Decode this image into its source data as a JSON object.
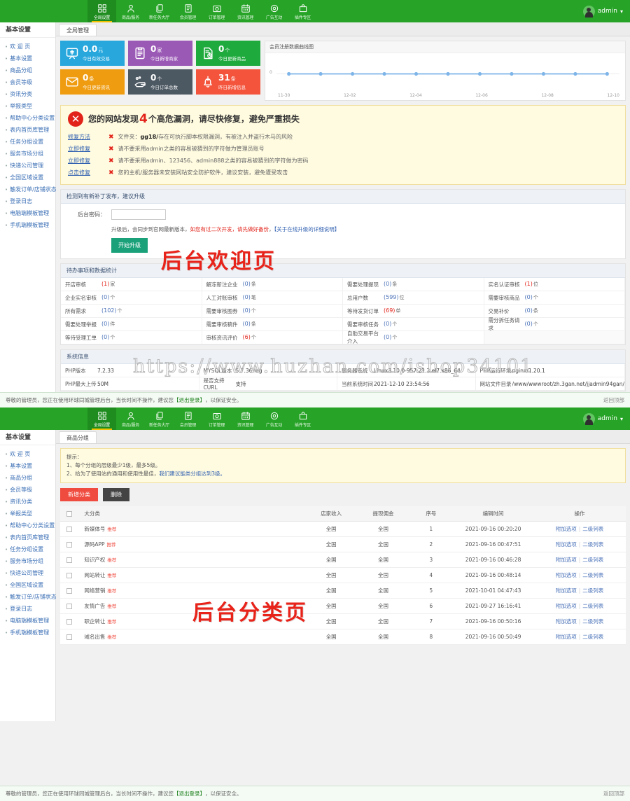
{
  "nav": {
    "items": [
      {
        "label": "全局设置",
        "icon": "grid-icon",
        "active": true
      },
      {
        "label": "商品/服务",
        "icon": "user-icon",
        "active": false
      },
      {
        "label": "新任务大厅",
        "icon": "copy-icon",
        "active": false
      },
      {
        "label": "会员管理",
        "icon": "book-icon",
        "active": false
      },
      {
        "label": "订单管理",
        "icon": "camera-icon",
        "active": false
      },
      {
        "label": "资讯管理",
        "icon": "calendar-icon",
        "active": false
      },
      {
        "label": "广告互动",
        "icon": "gear-icon",
        "active": false
      },
      {
        "label": "插件专区",
        "icon": "bag-icon",
        "active": false
      }
    ],
    "user": "admin",
    "caret": "▾"
  },
  "sidebar": {
    "title": "基本设置",
    "items": [
      {
        "label": "欢 迎 页"
      },
      {
        "label": "基本设置"
      },
      {
        "label": "商品分组"
      },
      {
        "label": "会员等级"
      },
      {
        "label": "资讯分类"
      },
      {
        "label": "举报类型"
      },
      {
        "label": "帮助中心分类设置"
      },
      {
        "label": "表内首页库管理"
      },
      {
        "label": "任务分组设置"
      },
      {
        "label": "服务市场分组"
      },
      {
        "label": "快递公司管理"
      },
      {
        "label": "全国区域设置"
      },
      {
        "label": "触发订单/店铺状态"
      },
      {
        "label": "登录日志"
      },
      {
        "label": "电脑端模板管理"
      },
      {
        "label": "手机端模板管理"
      }
    ],
    "sidebar2_items": [
      {
        "label": "欢 迎 页"
      },
      {
        "label": "基本设置"
      },
      {
        "label": "商品分组"
      },
      {
        "label": "会员等级"
      },
      {
        "label": "资讯分类"
      },
      {
        "label": "举报类型"
      },
      {
        "label": "帮助中心分类设置"
      },
      {
        "label": "表内首页库管理"
      },
      {
        "label": "任务分组设置"
      },
      {
        "label": "服务市场分组"
      },
      {
        "label": "快递公司管理"
      },
      {
        "label": "全国区域设置"
      },
      {
        "label": "触发订单/店铺状态"
      },
      {
        "label": "登录日志"
      },
      {
        "label": "电脑端模板管理"
      },
      {
        "label": "手机端模板管理"
      }
    ]
  },
  "welcome": {
    "tab": "全局管理",
    "cards": [
      {
        "num": "0.0",
        "unit": "元",
        "label": "今日有效交易",
        "color": "#28a7dd",
        "icon": "money-icon"
      },
      {
        "num": "0",
        "unit": "家",
        "label": "今日新增商家",
        "color": "#9b59b6",
        "icon": "clipboard-icon"
      },
      {
        "num": "0",
        "unit": "个",
        "label": "今日更新商品",
        "color": "#1faa3e",
        "icon": "doc-clock-icon"
      },
      {
        "num": "0",
        "unit": "条",
        "label": "今日更新资讯",
        "color": "#ef9c10",
        "icon": "mail-icon"
      },
      {
        "num": "0",
        "unit": "个",
        "label": "今日订单总数",
        "color": "#4c5862",
        "icon": "hand-icon"
      },
      {
        "num": "31",
        "unit": "条",
        "label": "昨日新增信息",
        "color": "#f4543c",
        "icon": "bell-plus-icon"
      }
    ],
    "alert": {
      "title_pre": "您的网站发现",
      "title_num": "4",
      "title_post": "个高危漏洞，请尽快修复，避免严重损失",
      "rows": [
        {
          "link": "修复方法",
          "text_pre": "文件夹：",
          "text_bold": "gg18/",
          "text_post": "存在可执行脚本权限漏洞，有被注入并盗行木马的风险"
        },
        {
          "link": "立即修复",
          "text_pre": "请不要采用admin之类的容易被猜到的字符做为管理员账号",
          "text_bold": "",
          "text_post": ""
        },
        {
          "link": "立即修复",
          "text_pre": "请不要采用admin、123456、admin888之类的容易被猜到的字符做为密码",
          "text_bold": "",
          "text_post": ""
        },
        {
          "link": "点击修复",
          "text_pre": "您的主机/服务器未安装网站安全防护软件，建议安装，避免遭受攻击",
          "text_bold": "",
          "text_post": ""
        }
      ]
    },
    "upgrade": {
      "header": "检测到有新补丁发布，建议升级",
      "field_label": "后台密码：",
      "field_value": "",
      "field_placeholder": "",
      "note_pre": "升级后，会同步到官网最新版本，",
      "note_warn": "如您有过二次开发，请先做好备份",
      "note_mid": "，",
      "note_link": "【关于在线升级的详细说明】",
      "button": "开始升级"
    },
    "stats": {
      "header": "待办事项和数据统计",
      "rows": [
        [
          {
            "label": "开店审核",
            "value": "(1)",
            "unit": "家",
            "red": true
          },
          {
            "label": "解冻新注企业",
            "value": "(0)",
            "unit": "条",
            "red": false
          },
          {
            "label": "需要处理提现",
            "value": "(0)",
            "unit": "条",
            "red": false
          },
          {
            "label": "实名认证审核",
            "value": "(1)",
            "unit": "位",
            "red": true
          }
        ],
        [
          {
            "label": "企业实名审核",
            "value": "(0)",
            "unit": "个",
            "red": false
          },
          {
            "label": "人工对账审核",
            "value": "(0)",
            "unit": "笔",
            "red": false
          },
          {
            "label": "总用户数",
            "value": "(599)",
            "unit": "位",
            "red": false
          },
          {
            "label": "需要审核商品",
            "value": "(0)",
            "unit": "个",
            "red": false
          }
        ],
        [
          {
            "label": "所有需求",
            "value": "(102)",
            "unit": "个",
            "red": false
          },
          {
            "label": "需要审核图券",
            "value": "(0)",
            "unit": "个",
            "red": false
          },
          {
            "label": "等待发货订单",
            "value": "(69)",
            "unit": "单",
            "red": true
          },
          {
            "label": "交易补价",
            "value": "(0)",
            "unit": "条",
            "red": false
          }
        ],
        [
          {
            "label": "需要处理举报",
            "value": "(0)",
            "unit": "件",
            "red": false
          },
          {
            "label": "需要审核稿件",
            "value": "(0)",
            "unit": "条",
            "red": false
          },
          {
            "label": "需要审核任务",
            "value": "(0)",
            "unit": "个",
            "red": false
          },
          {
            "label": "需分拆任务请求",
            "value": "(0)",
            "unit": "个",
            "red": false
          }
        ],
        [
          {
            "label": "等待受理工单",
            "value": "(0)",
            "unit": "个",
            "red": false
          },
          {
            "label": "审核资讯评价",
            "value": "(6)",
            "unit": "个",
            "red": true
          },
          {
            "label": "自助交易平台介入",
            "value": "(0)",
            "unit": "个",
            "red": false
          },
          {
            "label": "",
            "value": "",
            "unit": "",
            "red": false
          }
        ]
      ]
    },
    "sysinfo": {
      "header": "系统信息",
      "rows": [
        [
          {
            "label": "PHP版本",
            "value": "7.2.33"
          },
          {
            "label": "MYSQL版本",
            "value": "5.7.36-log"
          },
          {
            "label": "服务器系统",
            "value": "Linux3.10.0-957.21.3.el7.x86_64"
          },
          {
            "label": "PHP运行环境",
            "value": "nginx/1.20.1"
          }
        ],
        [
          {
            "label": "PHP最大上传",
            "value": "50M"
          },
          {
            "label": "是否支持CURL",
            "value": "支持"
          },
          {
            "label": "当前系统时间",
            "value": "2021-12-10 23:54:56"
          },
          {
            "label": "网站文件目录",
            "value": "/www/wwwroot/zh.3gan.net/jjadmin94gan/"
          }
        ]
      ]
    },
    "chart_data": {
      "type": "line",
      "title": "会员注册数据曲线图",
      "x": [
        "11-30",
        "",
        "12-02",
        "",
        "12-04",
        "",
        "12-06",
        "",
        "12-08",
        "",
        "12-10"
      ],
      "tick_labels": [
        "11-30",
        "12-02",
        "12-04",
        "12-06",
        "12-08",
        "12-10"
      ],
      "values": [
        0,
        0,
        0,
        0,
        0,
        0,
        0,
        0,
        0,
        0,
        0
      ],
      "ylabel": "",
      "xlabel": "",
      "ylim": [
        0,
        1
      ],
      "ytick_labels": [
        "0"
      ],
      "series_color": "#7eb5e8",
      "grid": false,
      "legend": false
    },
    "watermark": "后台欢迎页",
    "watermark_url": "https://www.huzhan.com/ishop34101"
  },
  "category": {
    "tab": "商品分组",
    "tip_title": "提示：",
    "tip_line1": "1、每个分组的层级最少1级，最多5级。",
    "tip_line2_pre": "2、给为了使用站的通用和使用性最佳，",
    "tip_line2_link": "我们建议能类分组达到3级。",
    "btn_add": "新增分类",
    "btn_del": "删除",
    "columns": [
      "大分类",
      "店家收入",
      "提现佣金",
      "序号",
      "编辑时间",
      "操作"
    ],
    "op_links": [
      "附加选项",
      "二级列表"
    ],
    "badge": "推荐",
    "rows": [
      {
        "name": "新媒体号",
        "income": "全国",
        "commission": "全国",
        "no": "1",
        "time": "2021-09-16 00:20:20"
      },
      {
        "name": "源码APP",
        "income": "全国",
        "commission": "全国",
        "no": "2",
        "time": "2021-09-16 00:47:51"
      },
      {
        "name": "知识产权",
        "income": "全国",
        "commission": "全国",
        "no": "3",
        "time": "2021-09-16 00:46:28"
      },
      {
        "name": "网站转让",
        "income": "全国",
        "commission": "全国",
        "no": "4",
        "time": "2021-09-16 00:48:14"
      },
      {
        "name": "网络营销",
        "income": "全国",
        "commission": "全国",
        "no": "5",
        "time": "2021-10-01 04:47:43"
      },
      {
        "name": "友情广告",
        "income": "全国",
        "commission": "全国",
        "no": "6",
        "time": "2021-09-27 16:16:41"
      },
      {
        "name": "职企转让",
        "income": "全国",
        "commission": "全国",
        "no": "7",
        "time": "2021-09-16 00:50:16"
      },
      {
        "name": "域名出售",
        "income": "全国",
        "commission": "全国",
        "no": "8",
        "time": "2021-09-16 00:50:49"
      }
    ],
    "watermark": "后台分类页"
  },
  "footer": {
    "text_pre": "尊敬的管理员，您正在使用环球同城管理后台，当长时间不操作，建议您",
    "link": "【退出登录】",
    "text_post": "，以保证安全。",
    "right": "返回顶部"
  }
}
